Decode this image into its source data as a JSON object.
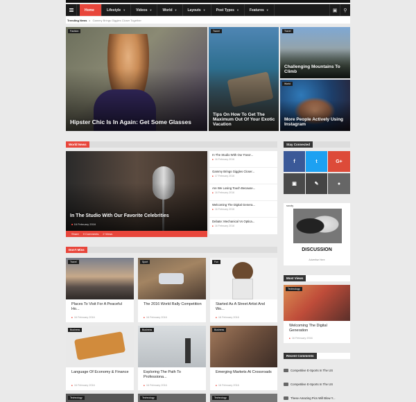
{
  "nav": {
    "items": [
      {
        "label": "Home",
        "active": true
      },
      {
        "label": "Lifestyle"
      },
      {
        "label": "Videos"
      },
      {
        "label": "World"
      },
      {
        "label": "Layouts"
      },
      {
        "label": "Post Types"
      },
      {
        "label": "Features"
      }
    ],
    "icons": [
      "menu-icon",
      "bag-icon",
      "search-icon"
    ]
  },
  "trending": {
    "label": "Trending News",
    "text": "Gammy Brings Giggles Closer Together"
  },
  "featured": [
    {
      "tag": "Fashion",
      "title": "Hipster Chic Is In Again: Get Some Glasses"
    },
    {
      "tag": "Travel",
      "title": "Tips On How To Get The Maximum Out Of Your Exotic Vacation"
    },
    {
      "tag": "Travel",
      "title": "Challenging Mountains To Climb"
    },
    {
      "tag": "World",
      "title": "More People Actively Using Instagram"
    }
  ],
  "world_news": {
    "heading": "World News",
    "main_title": "In The Studio With Our Favorite Celebrities",
    "main_date": "16 February 2016",
    "share": "Share",
    "comments": "0 Comments",
    "views": "2 Views",
    "list": [
      {
        "title": "In The Studio With Our Favor...",
        "date": "16 February 2016"
      },
      {
        "title": "Gammy Brings Giggles Closer...",
        "date": "17 February 2016"
      },
      {
        "title": "Are We Losing Touch Because...",
        "date": "16 February 2016"
      },
      {
        "title": "Welcoming The Digital Genera...",
        "date": "16 February 2016"
      },
      {
        "title": "Debate: Mechanical Vs Optica...",
        "date": "16 February 2016"
      }
    ]
  },
  "dont_miss": {
    "heading": "Don't Miss",
    "cards": [
      {
        "tag": "Travel",
        "title": "Places To Visit For A Peaceful Ho...",
        "date": "16 February 2016"
      },
      {
        "tag": "Sport",
        "title": "The 2016 World Rally Competition",
        "date": "16 February 2016"
      },
      {
        "tag": "Fun",
        "title": "Started As A Street Artist And Wo...",
        "date": "16 February 2016"
      },
      {
        "tag": "Business",
        "title": "Language Of Economy & Finance",
        "date": "16 February 2016"
      },
      {
        "tag": "Business",
        "title": "Exploring The Path To Professiona...",
        "date": "16 February 2016"
      },
      {
        "tag": "Business",
        "title": "Emerging Markets At Crossroads",
        "date": "16 February 2016"
      }
    ],
    "bottom_tags": [
      "Technology",
      "Technology",
      "Technology"
    ]
  },
  "sidebar": {
    "stay_connected": "Stay Connected",
    "ad_text": "DISCUSSION",
    "ad_sub": "Advertise Here",
    "ad_brand": "scouty",
    "most_views": "Most Views",
    "mv_tag": "Technology",
    "mv_title": "Welcoming The Digital Generation",
    "mv_date": "16 February 2016",
    "recent_comments": "Recent Comments",
    "comments": [
      "Competitive E-Sports In The US",
      "Competitive E-Sports In The US",
      "These Amazing Pics Will Blow Y..."
    ]
  },
  "colors": {
    "accent": "#e8463b",
    "facebook": "#3b5998",
    "twitter": "#1da1f2",
    "google": "#dd4b39",
    "instagram": "#4a4a4a",
    "pen": "#444444",
    "chat": "#666666"
  }
}
